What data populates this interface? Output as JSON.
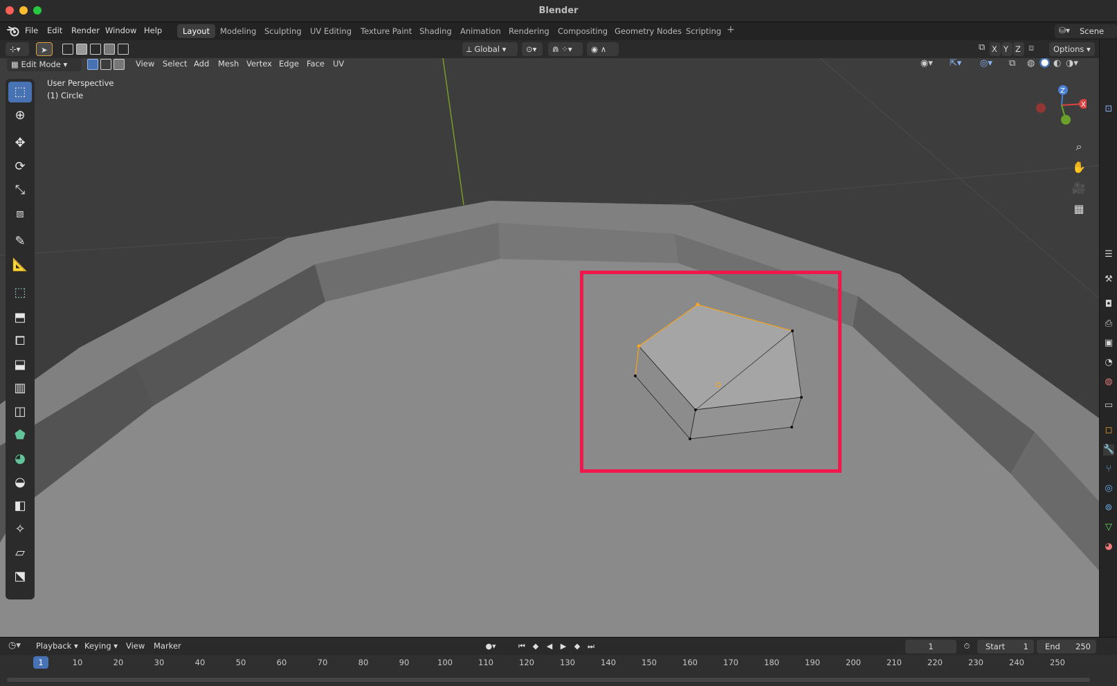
{
  "window": {
    "title": "Blender"
  },
  "menu": [
    "File",
    "Edit",
    "Render",
    "Window",
    "Help"
  ],
  "workspaces": {
    "active": "Layout",
    "tabs": [
      "Layout",
      "Modeling",
      "Sculpting",
      "UV Editing",
      "Texture Paint",
      "Shading",
      "Animation",
      "Rendering",
      "Compositing",
      "Geometry Nodes",
      "Scripting"
    ]
  },
  "scene": {
    "label": "Scene"
  },
  "tool_header": {
    "transform_orientation": "Global",
    "options_label": "Options",
    "axis_x": "X",
    "axis_y": "Y",
    "axis_z": "Z"
  },
  "viewport_header": {
    "mode": "Edit Mode",
    "menus": [
      "View",
      "Select",
      "Add",
      "Mesh",
      "Vertex",
      "Edge",
      "Face",
      "UV"
    ]
  },
  "viewport": {
    "perspective_label": "User Perspective",
    "object_label": "(1) Circle",
    "gizmo": {
      "z": "Z",
      "x": "X"
    }
  },
  "timeline": {
    "menus": [
      "Playback",
      "Keying",
      "View",
      "Marker"
    ],
    "current_frame": "1",
    "start_label": "Start",
    "start_value": "1",
    "end_label": "End",
    "end_value": "250",
    "marker_frame": "1",
    "ticks": [
      "10",
      "20",
      "30",
      "40",
      "50",
      "60",
      "70",
      "80",
      "90",
      "100",
      "110",
      "120",
      "130",
      "140",
      "150",
      "160",
      "170",
      "180",
      "190",
      "200",
      "210",
      "220",
      "230",
      "240",
      "250"
    ]
  },
  "colors": {
    "accent": "#4772b3",
    "highlight_box": "#f0174d",
    "selected_edge": "#f5a623"
  }
}
